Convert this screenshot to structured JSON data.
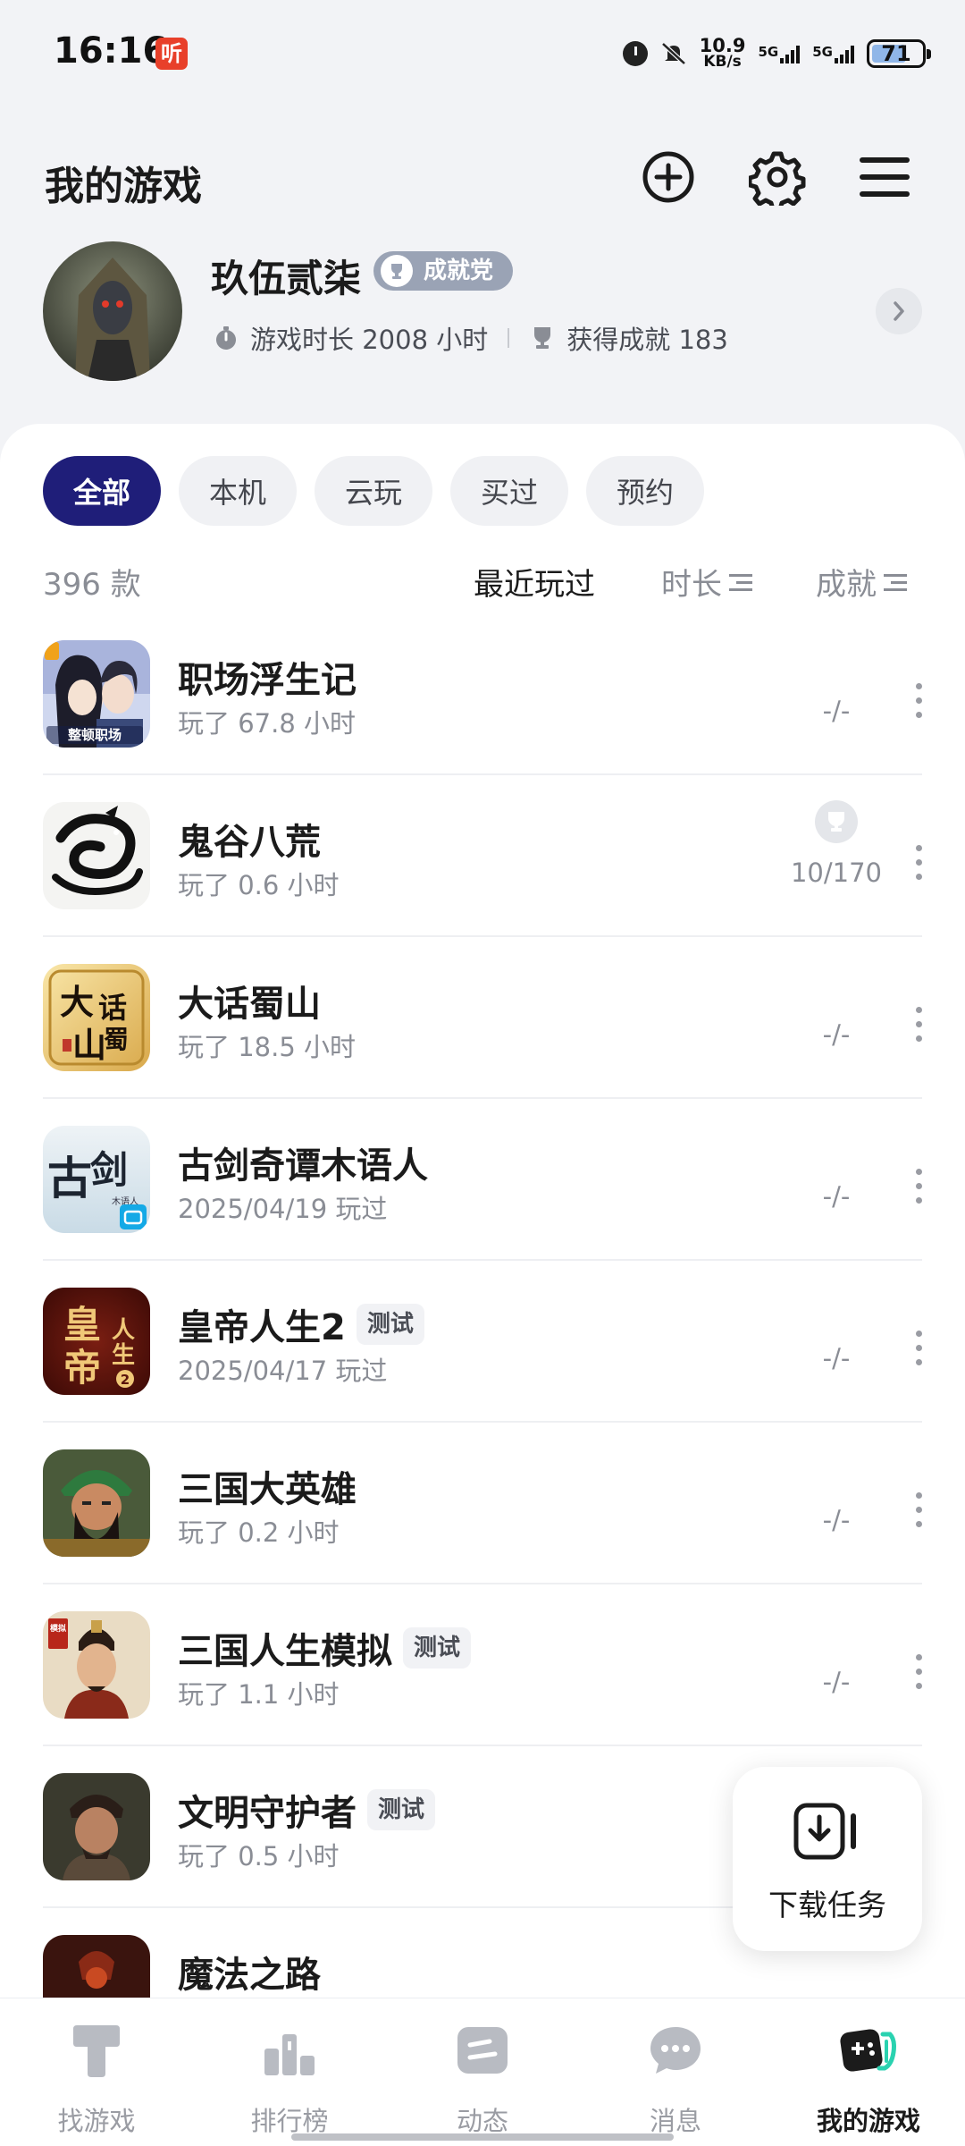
{
  "status_bar": {
    "time": "16:16",
    "app_badge": "听",
    "net_speed_value": "10.9",
    "net_speed_unit": "KB/s",
    "sim1": "5G",
    "sim2": "5G",
    "battery": "71",
    "battery_level": 0.71
  },
  "header": {
    "title": "我的游戏",
    "add_icon": "plus-circle-icon",
    "settings_icon": "gear-icon",
    "menu_icon": "hamburger-icon"
  },
  "profile": {
    "username": "玖伍贰柒",
    "badge": "成就党",
    "playtime": "游戏时长 2008 小时",
    "achievements": "获得成就 183"
  },
  "filters": {
    "tabs": [
      {
        "label": "全部",
        "active": true
      },
      {
        "label": "本机",
        "active": false
      },
      {
        "label": "云玩",
        "active": false
      },
      {
        "label": "买过",
        "active": false
      },
      {
        "label": "预约",
        "active": false
      }
    ]
  },
  "list_header": {
    "count": "396 款",
    "sort_recent": "最近玩过",
    "sort_duration": "时长",
    "sort_achievement": "成就"
  },
  "games": [
    {
      "name": "职场浮生记",
      "sub": "玩了 67.8 小时",
      "tag": "",
      "achievement": "-/-"
    },
    {
      "name": "鬼谷八荒",
      "sub": "玩了 0.6 小时",
      "tag": "",
      "achievement": "10/170"
    },
    {
      "name": "大话蜀山",
      "sub": "玩了 18.5 小时",
      "tag": "",
      "achievement": "-/-"
    },
    {
      "name": "古剑奇谭木语人",
      "sub": "2025/04/19 玩过",
      "tag": "",
      "achievement": "-/-"
    },
    {
      "name": "皇帝人生2",
      "sub": "2025/04/17 玩过",
      "tag": "测试",
      "achievement": "-/-"
    },
    {
      "name": "三国大英雄",
      "sub": "玩了 0.2 小时",
      "tag": "",
      "achievement": "-/-"
    },
    {
      "name": "三国人生模拟",
      "sub": "玩了 1.1 小时",
      "tag": "测试",
      "achievement": "-/-"
    },
    {
      "name": "文明守护者",
      "sub": "玩了 0.5 小时",
      "tag": "测试",
      "achievement": ""
    },
    {
      "name": "魔法之路",
      "sub": "",
      "tag": "",
      "achievement": ""
    }
  ],
  "game_icon_text": {
    "g1_logo": "整顿职场",
    "g3_a": "大",
    "g3_b": "话",
    "g3_c": "蜀",
    "g3_d": "山",
    "g4_a": "古",
    "g4_b": "剑",
    "g4_c": "木语人",
    "g5_a": "皇",
    "g5_b": "帝",
    "g5_c": "人",
    "g5_d": "生",
    "g5_e": "2",
    "g7_tag": "模拟"
  },
  "download_fab": {
    "label": "下载任务"
  },
  "bottom_nav": [
    {
      "label": "找游戏",
      "icon": "t-shape-icon",
      "active": false
    },
    {
      "label": "排行榜",
      "icon": "podium-icon",
      "active": false
    },
    {
      "label": "动态",
      "icon": "feed-card-icon",
      "active": false
    },
    {
      "label": "消息",
      "icon": "chat-bubble-icon",
      "active": false
    },
    {
      "label": "我的游戏",
      "icon": "gamepad-icon",
      "active": true
    }
  ],
  "colors": {
    "accent": "#1f1e79",
    "background": "#f2f3f6",
    "badge": "#9aa3b5"
  }
}
